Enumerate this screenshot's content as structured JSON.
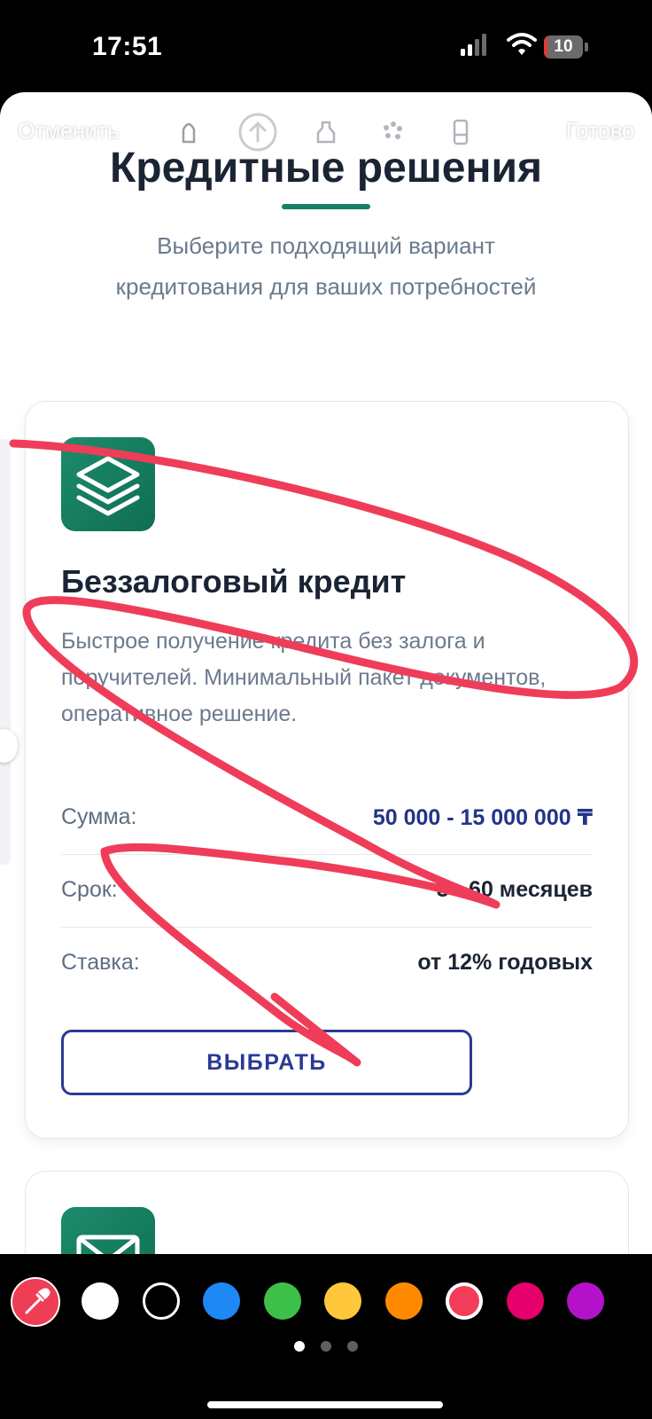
{
  "status_bar": {
    "time": "17:51",
    "battery_level": "10",
    "battery_fraction": 0.1
  },
  "markup_toolbar": {
    "cancel_label": "Отменить",
    "done_label": "Готово",
    "tools": [
      "pen-tool-icon",
      "arrow-up-circle-icon",
      "marker-tool-icon",
      "color-palette-icon",
      "eraser-tool-icon"
    ]
  },
  "page": {
    "title": "Кредитные решения",
    "subtitle": "Выберите подходящий вариант кредитования для ваших потребностей"
  },
  "loan_card": {
    "icon": "stacked-layers-icon",
    "title": "Беззалоговый кредит",
    "description": "Быстрое получение кредита без залога и поручителей. Минимальный пакет документов, оперативное решение.",
    "rows": [
      {
        "label": "Сумма:",
        "value": "50 000 - 15 000 000 ₸"
      },
      {
        "label": "Срок:",
        "value": "3 - 60 месяцев"
      },
      {
        "label": "Ставка:",
        "value": "от 12% годовых"
      }
    ],
    "button_label": "ВЫБРАТЬ"
  },
  "next_card": {
    "icon": "envelope-icon"
  },
  "color_palette": {
    "colors": [
      "#ffffff",
      "#000000",
      "#1e88f5",
      "#3cc04a",
      "#ffc83a",
      "#ff8a00",
      "#f23c58",
      "#e5006b",
      "#b312c8"
    ],
    "selected_color": "#f23c58",
    "accent": "#168064",
    "button_accent": "#2a3a94"
  },
  "pager": {
    "pages": 3,
    "active": 1
  }
}
